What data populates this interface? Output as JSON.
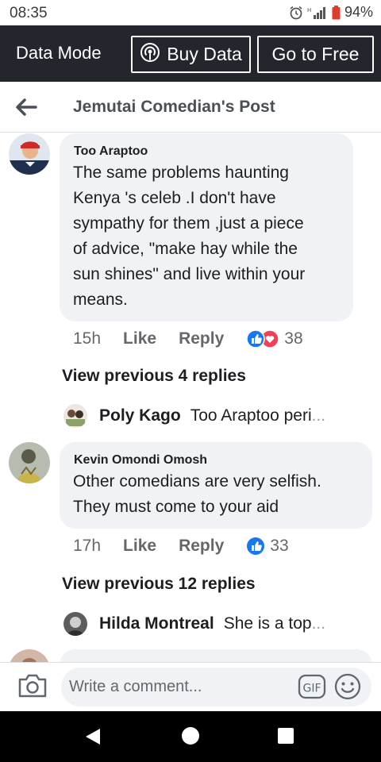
{
  "status_bar": {
    "time": "08:35",
    "battery": "94%"
  },
  "data_bar": {
    "title": "Data Mode",
    "buy_label": "Buy Data",
    "free_label": "Go to Free"
  },
  "header": {
    "title": "Jemutai Comedian's Post"
  },
  "comments": [
    {
      "author": "Too Araptoo",
      "lines": [
        "The same problems haunting",
        "Kenya 's celeb .I don't have",
        "sympathy for them ,just a piece",
        "of advice, \"make hay while the",
        "sun shines\" and live within your",
        "means."
      ],
      "time": "15h",
      "like": "Like",
      "reply": "Reply",
      "reactions_count": "38",
      "view_previous": "View previous 4 replies",
      "latest_reply": {
        "name": "Poly Kago",
        "text": "Too Araptoo peri",
        "ellipsis": "..."
      }
    },
    {
      "author": "Kevin Omondi Omosh",
      "lines": [
        "Other comedians are very selfish.",
        "They must come to your aid"
      ],
      "time": "17h",
      "like": "Like",
      "reply": "Reply",
      "reactions_count": "33",
      "view_previous": "View previous 12 replies",
      "latest_reply": {
        "name": "Hilda Montreal",
        "text": "She is a top",
        "ellipsis": "..."
      }
    }
  ],
  "composer": {
    "placeholder": "Write a comment...",
    "gif_label": "GIF"
  },
  "colors": {
    "data_bar_bg": "#23272d",
    "bubble_bg": "#f0f2f5",
    "like_blue": "#1877f2",
    "love_red": "#f33e58"
  }
}
